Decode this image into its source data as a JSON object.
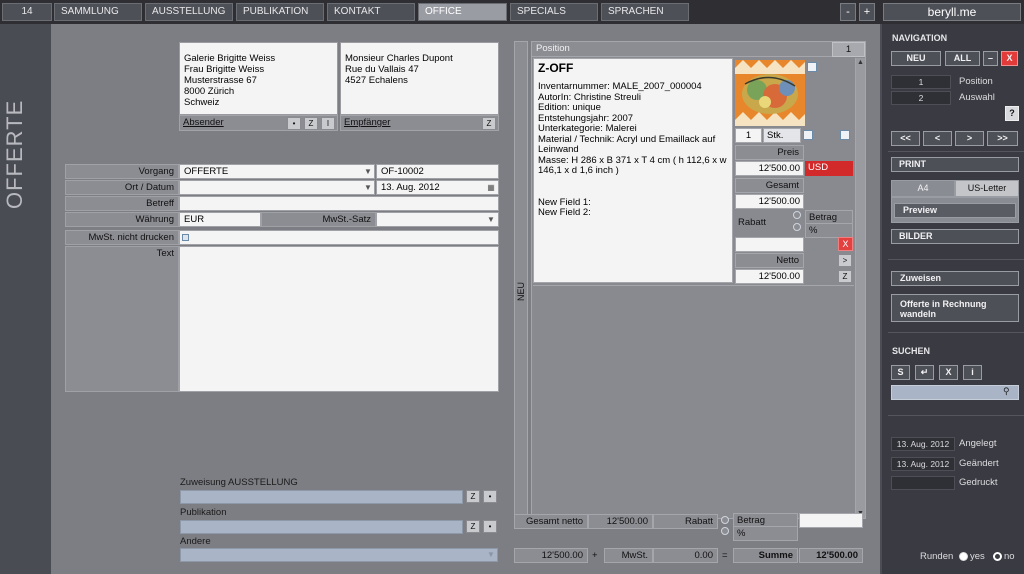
{
  "topbar": {
    "record_number": "14",
    "tabs": [
      "SAMMLUNG",
      "AUSSTELLUNG",
      "PUBLIKATION",
      "KONTAKT",
      "OFFICE",
      "SPECIALS",
      "SPRACHEN"
    ],
    "minus": "-",
    "plus": "+",
    "brand": "beryll.me"
  },
  "page_title": "OFFERTE",
  "sender": {
    "lines": "Galerie Brigitte Weiss\nFrau Brigitte Weiss\nMusterstrasse 67\n8000 Zürich\nSchweiz",
    "label": "Absender",
    "btn_dot": "•",
    "btn_z": "Z",
    "btn_i": "I"
  },
  "recipient": {
    "lines": "Monsieur Charles Dupont\nRue du Vallais 47\n4527 Echalens",
    "label": "Empfänger",
    "btn_z": "Z"
  },
  "form": {
    "vorgang_label": "Vorgang",
    "vorgang_value": "OFFERTE",
    "vorgang_number": "OF-10002",
    "ort_label": "Ort / Datum",
    "ort_value": "",
    "date_value": "13. Aug. 2012",
    "betreff_label": "Betreff",
    "waehrung_label": "Währung",
    "waehrung_value": "EUR",
    "mwst_satz_label": "MwSt.-Satz",
    "mwst_not_print_label": "MwSt. nicht drucken",
    "text_label": "Text"
  },
  "assign": {
    "ausstellung_label": "Zuweisung AUSSTELLUNG",
    "publikation_label": "Publikation",
    "andere_label": "Andere",
    "btn_z": "Z",
    "btn_dot": "•"
  },
  "position": {
    "neu_label": "NEU",
    "header_label": "Position",
    "count": "1",
    "title": "Z-OFF",
    "details": "Inventarnummer: MALE_2007_000004\nAutorIn: Christine Streuli\nEdition: unique\nEntstehungsjahr: 2007\nUnterkategorie: Malerei\nMaterial / Technik: Acryl und Emaillack auf Leinwand\nMasse: H 286 x B 371 x T 4 cm  ( h 112,6 x w 146,1 x d 1,6 inch )\n\n\nNew Field 1:\nNew Field 2:",
    "qty": "1",
    "qty_unit": "Stk.",
    "preis_label": "Preis",
    "price": "12'500.00",
    "currency": "USD",
    "gesamt_label": "Gesamt",
    "gesamt": "12'500.00",
    "rabatt_label": "Rabatt",
    "betrag_label": "Betrag",
    "pct_label": "%",
    "x_label": "X",
    "netto_label": "Netto",
    "netto": "12'500.00",
    "arrow_label": ">",
    "z_label": "Z"
  },
  "totals": {
    "gesamt_netto_label": "Gesamt netto",
    "gesamt_netto": "12'500.00",
    "rabatt_label": "Rabatt",
    "betrag_label": "Betrag",
    "pct_label": "%",
    "subtotal": "12'500.00",
    "plus": "+",
    "mwst_label": "MwSt.",
    "mwst_value": "0.00",
    "equals": "=",
    "summe_label": "Summe",
    "summe": "12'500.00"
  },
  "sidebar": {
    "nav_heading": "NAVIGATION",
    "neu": "NEU",
    "all": "ALL",
    "minus": "–",
    "close": "X",
    "position_value": "1",
    "position_label": "Position",
    "auswahl_value": "2",
    "auswahl_label": "Auswahl",
    "help": "?",
    "first": "<<",
    "prev": "<",
    "next": ">",
    "last": ">>",
    "print_heading": "PRINT",
    "a4": "A4",
    "us_letter": "US-Letter",
    "preview": "Preview",
    "bilder_heading": "BILDER",
    "zuweisen": "Zuweisen",
    "convert": "Offerte in Rechnung wandeln",
    "suchen_heading": "SUCHEN",
    "s": "S",
    "enter": "↵",
    "x": "X",
    "i": "i",
    "angelegt_date": "13. Aug. 2012",
    "angelegt_label": "Angelegt",
    "geaendert_date": "13. Aug. 2012",
    "geaendert_label": "Geändert",
    "gedruckt_label": "Gedruckt",
    "runden_label": "Runden",
    "yes": "yes",
    "no": "no"
  },
  "colors": {
    "accent_red": "#d22a2a",
    "background_main": "#7d7e84",
    "sidebar": "#3a3b42",
    "active_tab": "#9a9ca4"
  }
}
